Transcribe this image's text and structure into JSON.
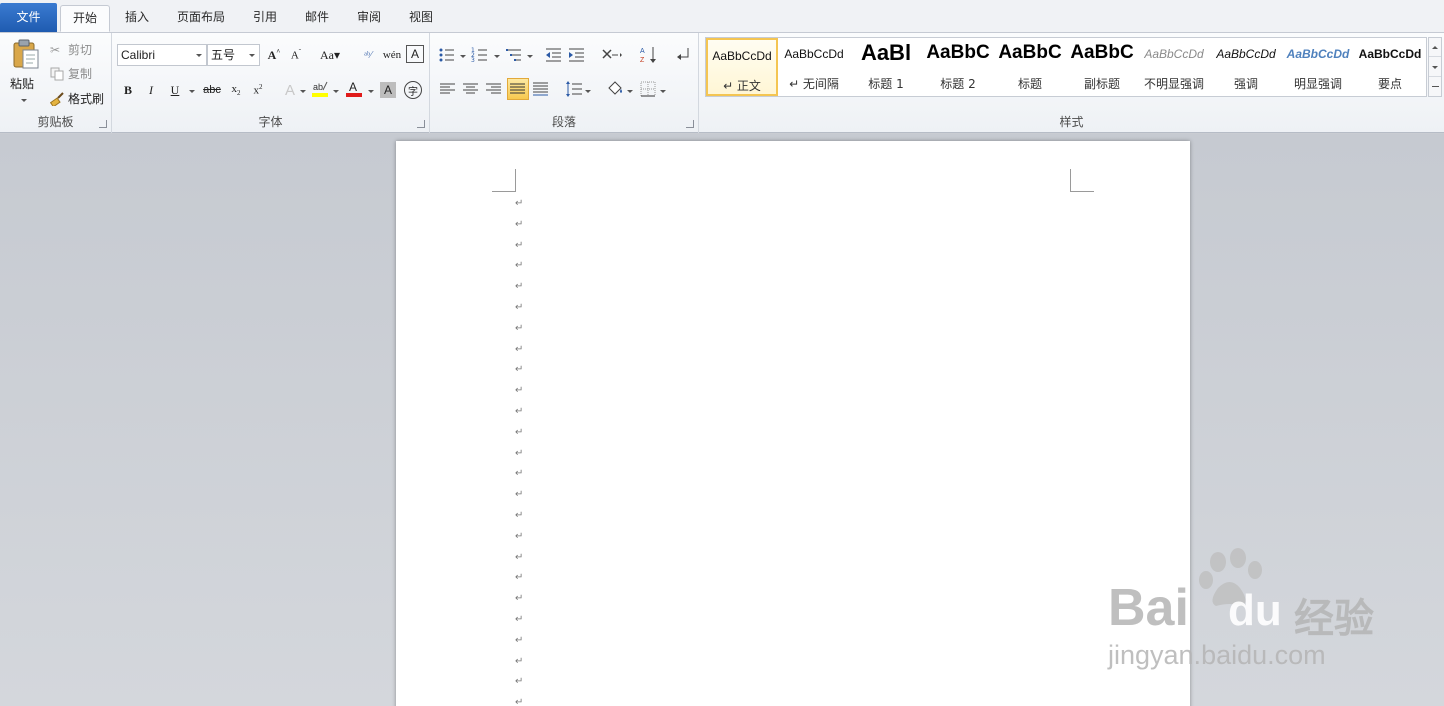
{
  "tabs": [
    {
      "label": "文件",
      "state": "file"
    },
    {
      "label": "开始",
      "state": "active"
    },
    {
      "label": "插入",
      "state": ""
    },
    {
      "label": "页面布局",
      "state": ""
    },
    {
      "label": "引用",
      "state": ""
    },
    {
      "label": "邮件",
      "state": ""
    },
    {
      "label": "审阅",
      "state": ""
    },
    {
      "label": "视图",
      "state": ""
    }
  ],
  "clipboard": {
    "paste": "粘贴",
    "cut": "剪切",
    "copy": "复制",
    "format_painter": "格式刷",
    "group_label": "剪贴板"
  },
  "font": {
    "font_name": "Calibri",
    "font_size": "五号",
    "group_label": "字体"
  },
  "paragraph": {
    "group_label": "段落"
  },
  "styles": {
    "group_label": "样式",
    "items": [
      {
        "sample": "AaBbCcDd",
        "name": "↵ 正文",
        "selected": true
      },
      {
        "sample": "AaBbCcDd",
        "name": "↵ 无间隔",
        "selected": false
      },
      {
        "sample": "AaBl",
        "name": "标题 1",
        "selected": false
      },
      {
        "sample": "AaBbC",
        "name": "标题 2",
        "selected": false
      },
      {
        "sample": "AaBbC",
        "name": "标题",
        "selected": false
      },
      {
        "sample": "AaBbC",
        "name": "副标题",
        "selected": false
      },
      {
        "sample": "AaBbCcDd",
        "name": "不明显强调",
        "selected": false
      },
      {
        "sample": "AaBbCcDd",
        "name": "强调",
        "selected": false
      },
      {
        "sample": "AaBbCcDd",
        "name": "明显强调",
        "selected": false
      },
      {
        "sample": "AaBbCcDd",
        "name": "要点",
        "selected": false
      }
    ]
  },
  "document": {
    "paragraph_mark": "↵",
    "paragraph_count": 25
  },
  "watermark": {
    "brand": "Bai",
    "brand_suffix": "du",
    "product": "经验",
    "url": "jingyan.baidu.com"
  },
  "colors": {
    "file_tab": "#2a6ac4",
    "highlight_yellow": "#ffff00",
    "font_color_red": "#e01b1b",
    "selected_style_border": "#f4c552"
  }
}
